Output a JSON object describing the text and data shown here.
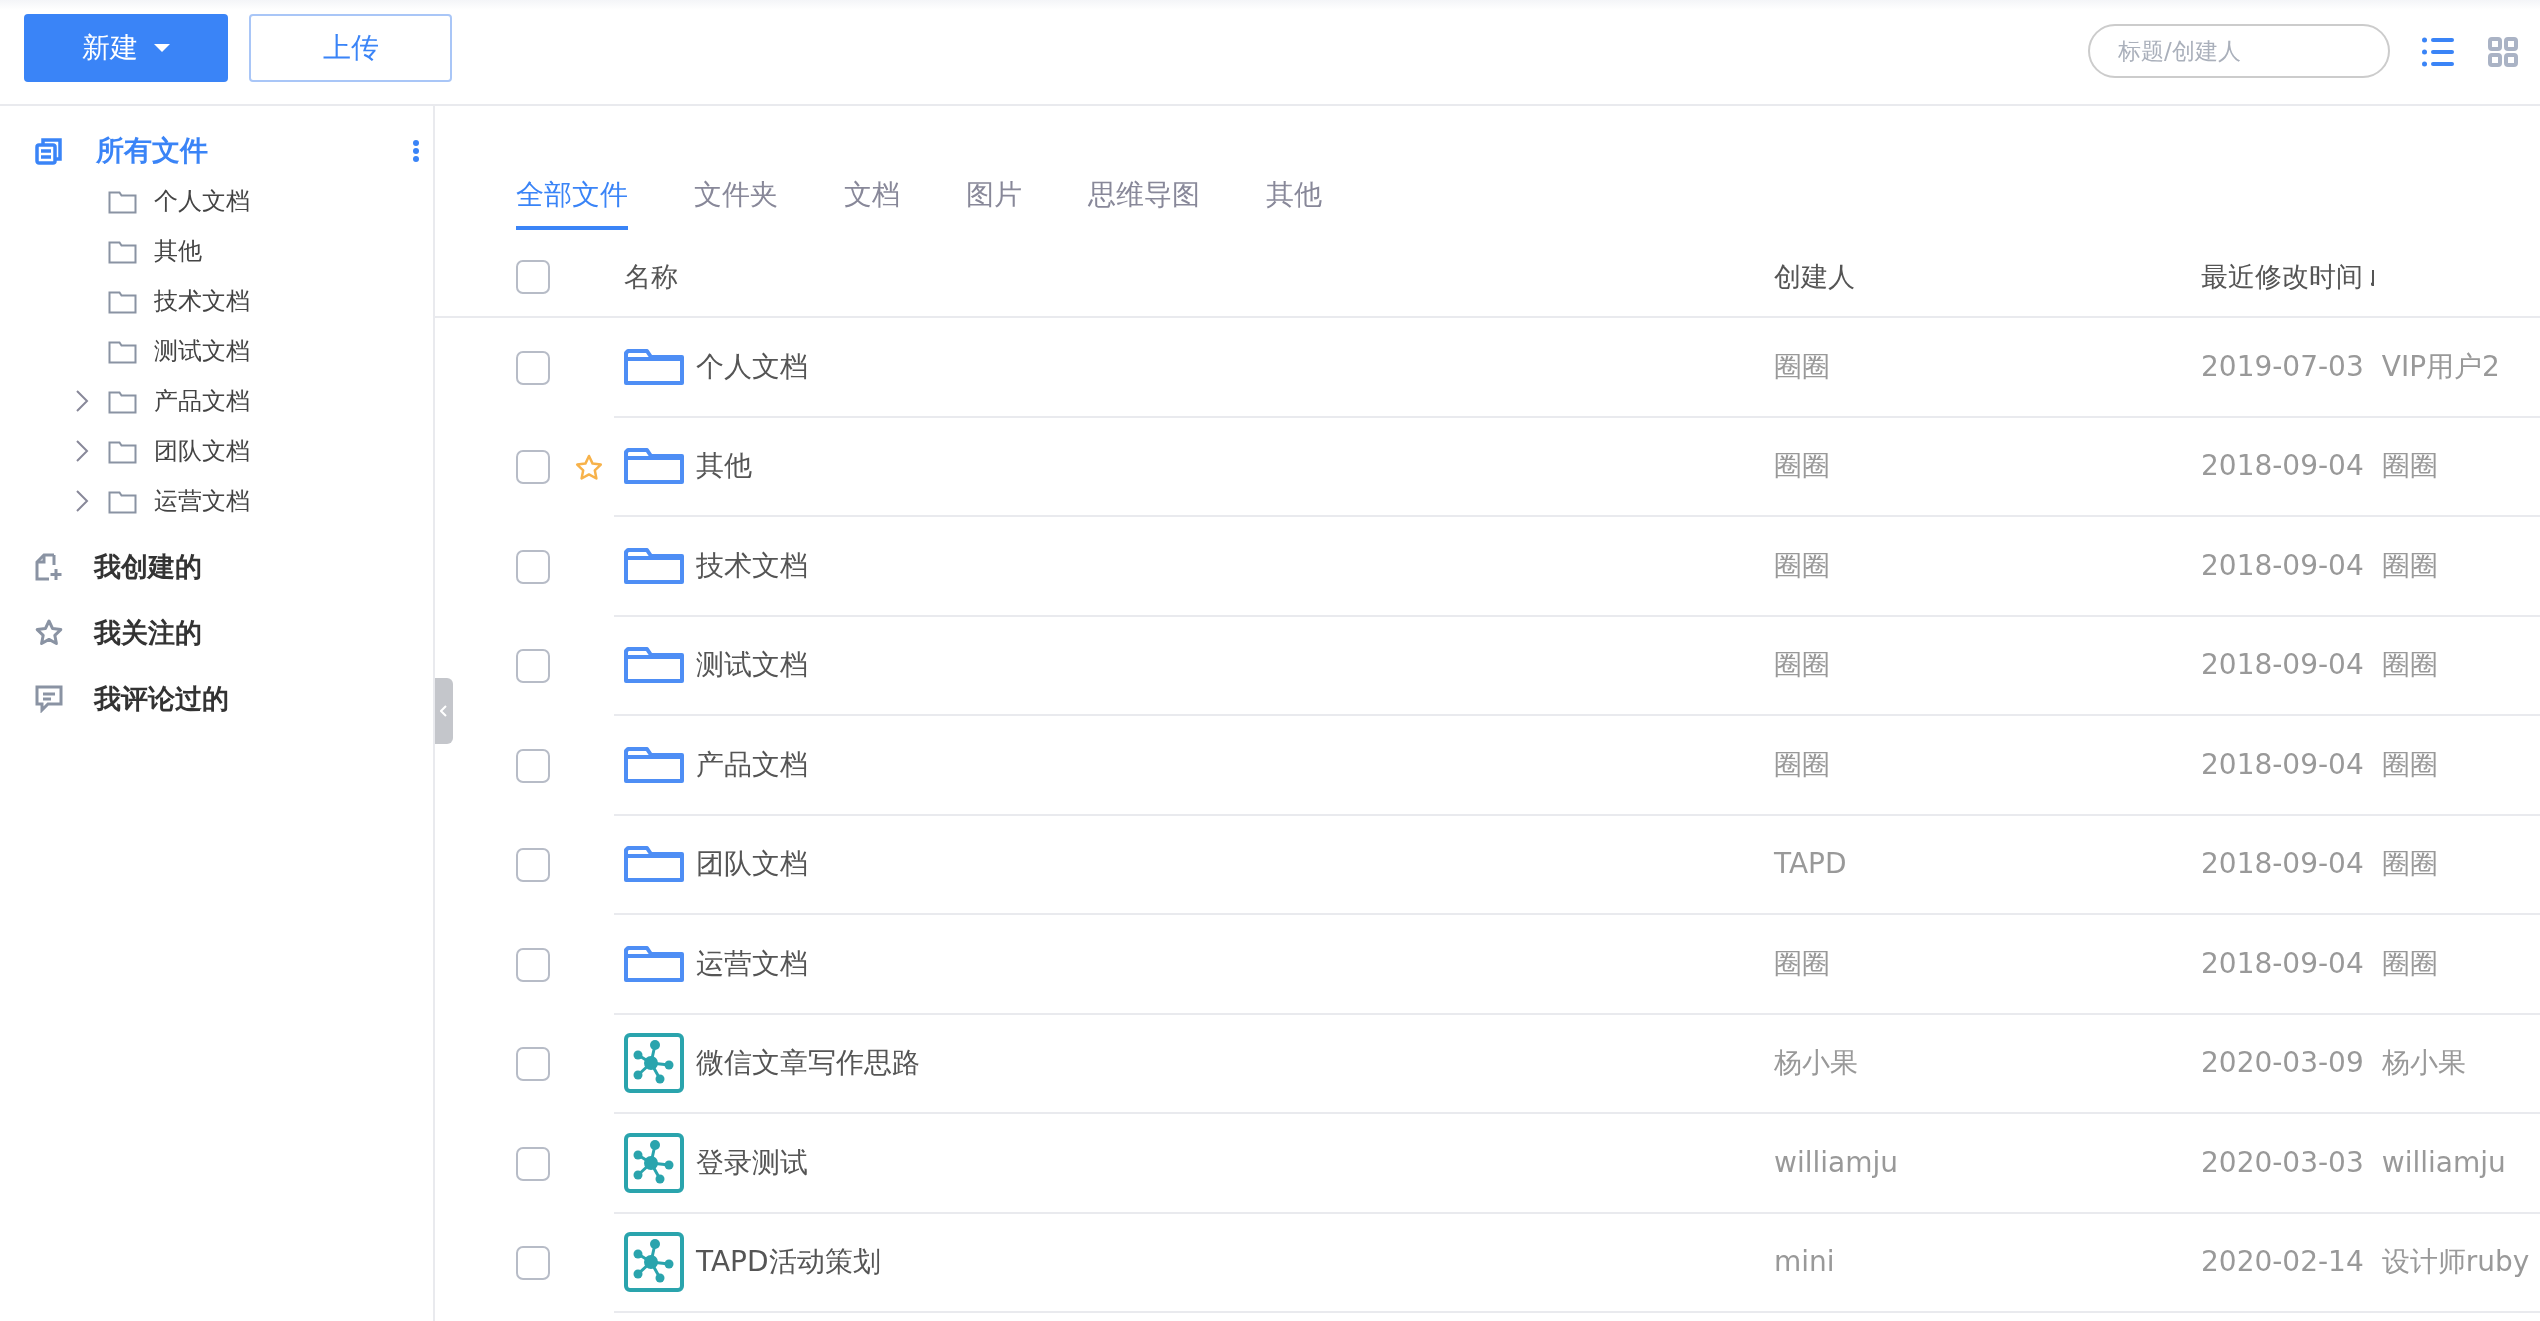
{
  "toolbar": {
    "new_button": {
      "label": "新建"
    },
    "upload_button": {
      "label": "上传"
    },
    "search": {
      "placeholder": "标题/创建人"
    },
    "views": [
      {
        "kind": "list",
        "selected": true
      },
      {
        "kind": "grid",
        "selected": false
      }
    ]
  },
  "sidebar": {
    "root": {
      "label": "所有文件",
      "selected": true,
      "children": [
        {
          "label": "个人文档",
          "expandable": false
        },
        {
          "label": "其他",
          "expandable": false
        },
        {
          "label": "技术文档",
          "expandable": false
        },
        {
          "label": "测试文档",
          "expandable": false
        },
        {
          "label": "产品文档",
          "expandable": true
        },
        {
          "label": "团队文档",
          "expandable": true
        },
        {
          "label": "运营文档",
          "expandable": true
        }
      ]
    },
    "items": [
      {
        "kind": "created",
        "label": "我创建的"
      },
      {
        "kind": "followed",
        "label": "我关注的"
      },
      {
        "kind": "commented",
        "label": "我评论过的"
      }
    ]
  },
  "tabs": [
    {
      "label": "全部文件",
      "selected": true
    },
    {
      "label": "文件夹",
      "selected": false
    },
    {
      "label": "文档",
      "selected": false
    },
    {
      "label": "图片",
      "selected": false
    },
    {
      "label": "思维导图",
      "selected": false
    },
    {
      "label": "其他",
      "selected": false
    }
  ],
  "table": {
    "select_all_checked": false,
    "columns": [
      "名称",
      "创建人",
      "最近修改时间"
    ],
    "rows": [
      {
        "kind": "folder",
        "name": "个人文档",
        "checked": false,
        "starred": false,
        "creator": "圈圈",
        "date": "2019-07-03",
        "modifier": "VIP用户2"
      },
      {
        "kind": "folder",
        "name": "其他",
        "checked": false,
        "starred": true,
        "creator": "圈圈",
        "date": "2018-09-04",
        "modifier": "圈圈"
      },
      {
        "kind": "folder",
        "name": "技术文档",
        "checked": false,
        "starred": false,
        "creator": "圈圈",
        "date": "2018-09-04",
        "modifier": "圈圈"
      },
      {
        "kind": "folder",
        "name": "测试文档",
        "checked": false,
        "starred": false,
        "creator": "圈圈",
        "date": "2018-09-04",
        "modifier": "圈圈"
      },
      {
        "kind": "folder",
        "name": "产品文档",
        "checked": false,
        "starred": false,
        "creator": "圈圈",
        "date": "2018-09-04",
        "modifier": "圈圈"
      },
      {
        "kind": "folder",
        "name": "团队文档",
        "checked": false,
        "starred": false,
        "creator": "TAPD",
        "date": "2018-09-04",
        "modifier": "圈圈"
      },
      {
        "kind": "folder",
        "name": "运营文档",
        "checked": false,
        "starred": false,
        "creator": "圈圈",
        "date": "2018-09-04",
        "modifier": "圈圈"
      },
      {
        "kind": "mindmap",
        "name": "微信文章写作思路",
        "checked": false,
        "starred": false,
        "creator": "杨小果",
        "date": "2020-03-09",
        "modifier": "杨小果"
      },
      {
        "kind": "mindmap",
        "name": "登录测试",
        "checked": false,
        "starred": false,
        "creator": "williamju",
        "date": "2020-03-03",
        "modifier": "williamju"
      },
      {
        "kind": "mindmap",
        "name": "TAPD活动策划",
        "checked": false,
        "starred": false,
        "creator": "mini",
        "date": "2020-02-14",
        "modifier": "设计师ruby"
      }
    ]
  }
}
